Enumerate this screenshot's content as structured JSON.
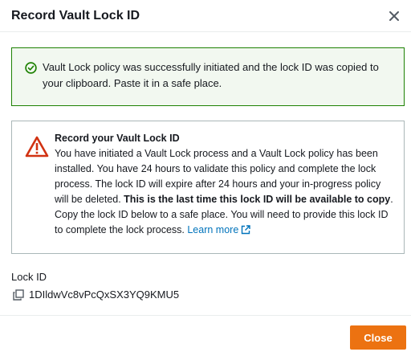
{
  "modal": {
    "title": "Record Vault Lock ID"
  },
  "success_alert": {
    "message": "Vault Lock policy was successfully initiated and the lock ID was copied to your clipboard. Paste it in a safe place.",
    "color": "#1d8102"
  },
  "warning_alert": {
    "title": "Record your Vault Lock ID",
    "body_part1": "You have initiated a Vault Lock process and a Vault Lock policy has been installed. You have 24 hours to validate this policy and complete the lock process. The lock ID will expire after 24 hours and your in-progress policy will be deleted. ",
    "body_bold": "This is the last time this lock ID will be available to copy",
    "body_part2": ". Copy the lock ID below to a safe place. You will need to provide this lock ID to complete the lock process. ",
    "link_text": "Learn more",
    "icon_color": "#d13212"
  },
  "lock_id": {
    "label": "Lock ID",
    "value": "1DIldwVc8vPcQxSX3YQ9KMU5"
  },
  "footer": {
    "close_label": "Close",
    "accent": "#ec7211"
  },
  "icons": {
    "close": "close-icon",
    "success": "check-circle-icon",
    "warning": "warning-triangle-icon",
    "external": "external-link-icon",
    "copy": "copy-icon"
  }
}
